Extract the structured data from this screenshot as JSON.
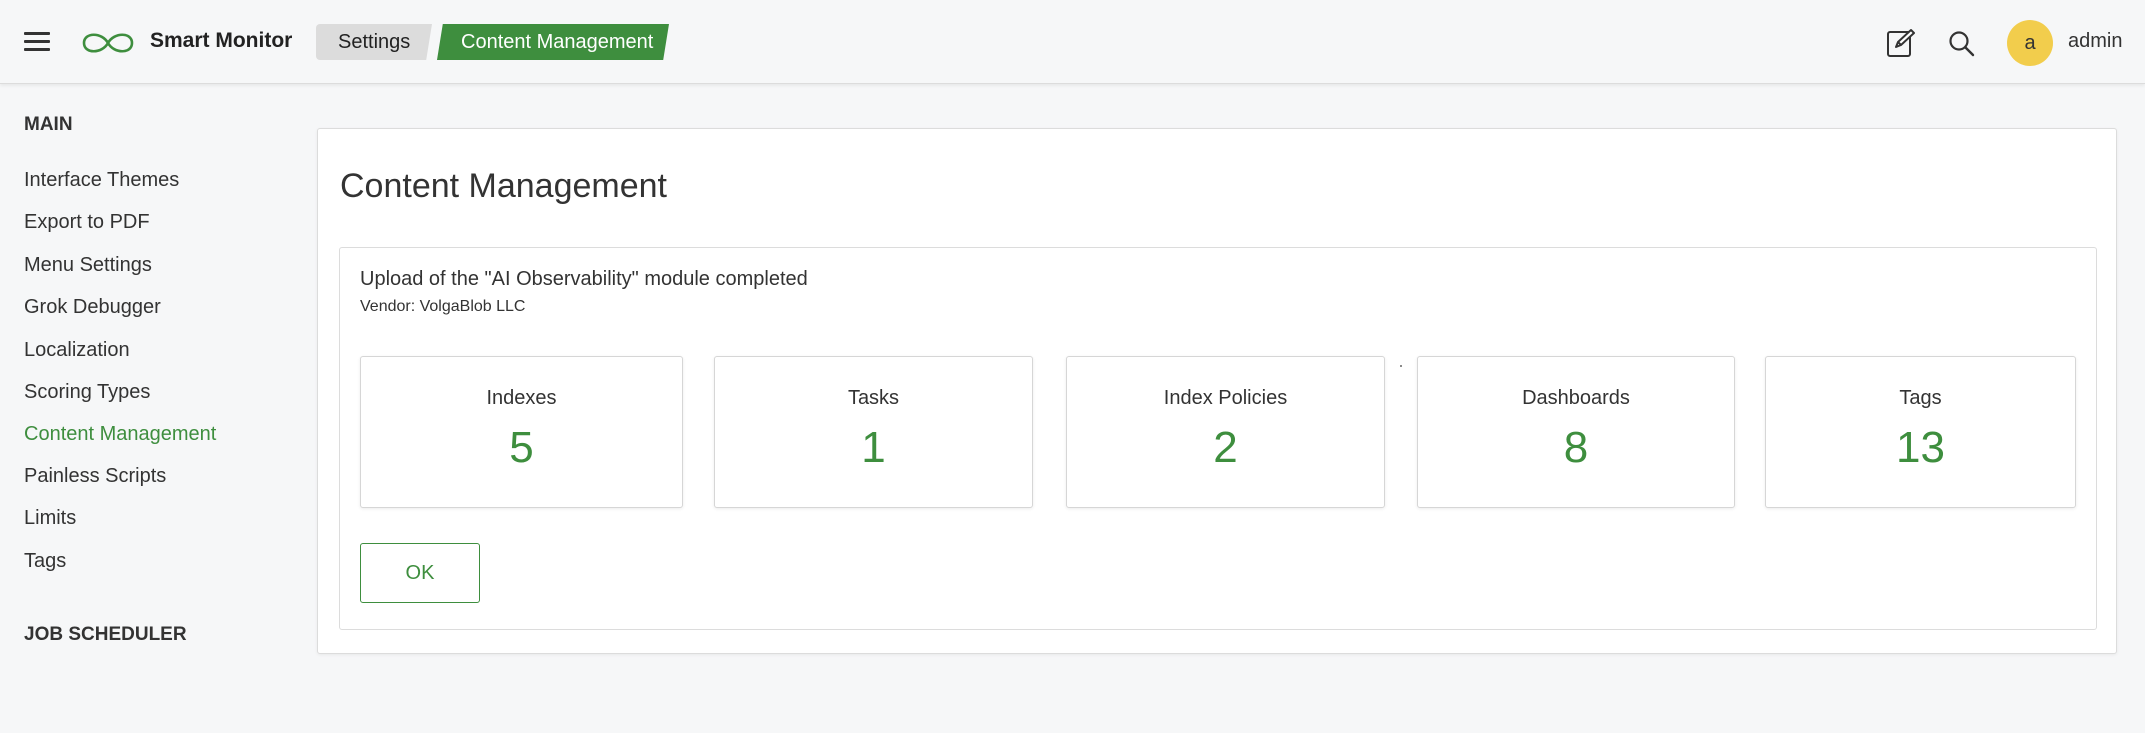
{
  "header": {
    "brand": "Smart Monitor",
    "breadcrumb": [
      "Settings",
      "Content Management"
    ],
    "user": {
      "avatar_letter": "a",
      "name": "admin",
      "avatar_color": "#f2cd4c"
    },
    "icons": [
      "hamburger-menu-icon",
      "infinity-logo-icon",
      "edit-icon",
      "search-icon"
    ]
  },
  "sidebar": {
    "sections": [
      {
        "heading": "MAIN",
        "items": [
          "Interface Themes",
          "Export to PDF",
          "Menu Settings",
          "Grok Debugger",
          "Localization",
          "Scoring Types",
          "Content Management",
          "Painless Scripts",
          "Limits",
          "Tags"
        ]
      },
      {
        "heading": "JOB SCHEDULER",
        "items": []
      }
    ],
    "active_item": "Content Management"
  },
  "main": {
    "title": "Content Management",
    "upload_message": "Upload of the \"AI Observability\" module completed",
    "vendor": "Vendor: VolgaBlob LLC",
    "stats": [
      {
        "label": "Indexes",
        "value": "5"
      },
      {
        "label": "Tasks",
        "value": "1"
      },
      {
        "label": "Index Policies",
        "value": "2"
      },
      {
        "label": "Dashboards",
        "value": "8"
      },
      {
        "label": "Tags",
        "value": "13"
      }
    ],
    "ok_label": "OK"
  },
  "colors": {
    "accent": "#3e8e3e",
    "background": "#f6f7f8",
    "panel": "#ffffff"
  }
}
